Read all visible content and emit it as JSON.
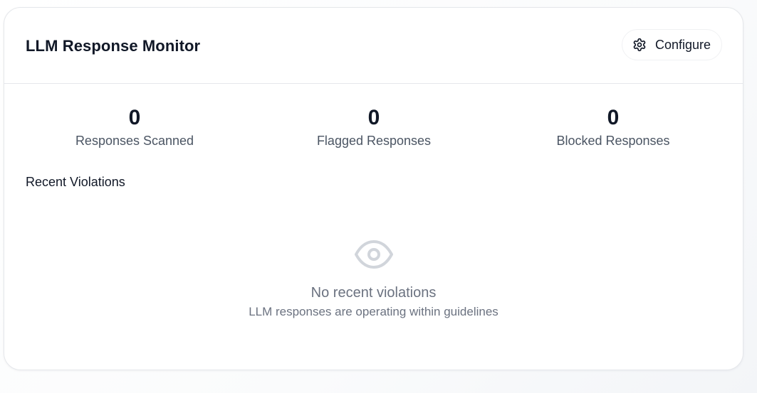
{
  "header": {
    "title": "LLM Response Monitor",
    "configure_label": "Configure",
    "configure_icon": "gear-icon"
  },
  "stats": [
    {
      "value": "0",
      "label": "Responses Scanned"
    },
    {
      "value": "0",
      "label": "Flagged Responses"
    },
    {
      "value": "0",
      "label": "Blocked Responses"
    }
  ],
  "recent": {
    "title": "Recent Violations",
    "empty_icon": "eye-icon",
    "empty_heading": "No recent violations",
    "empty_subtext": "LLM responses are operating within guidelines"
  },
  "colors": {
    "text_primary": "#111827",
    "text_muted": "#6b7280",
    "border": "#e5e7eb",
    "icon_muted": "#d1d5db"
  }
}
